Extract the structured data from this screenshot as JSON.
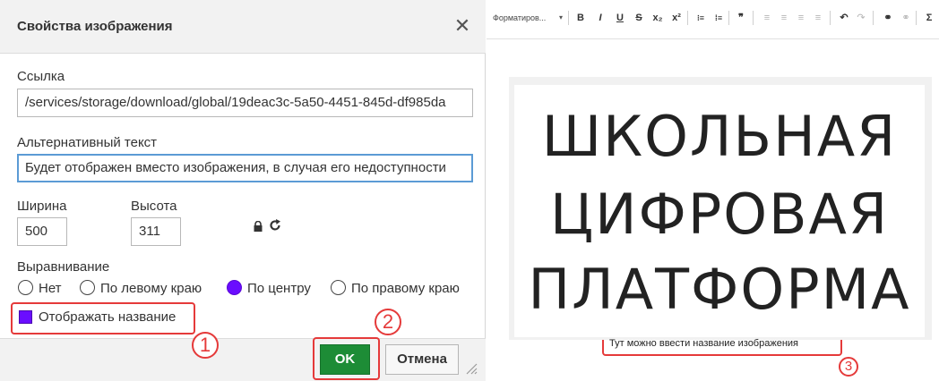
{
  "dialog": {
    "title": "Свойства изображения",
    "close_symbol": "✕",
    "link_label": "Ссылка",
    "link_value": "/services/storage/download/global/19deac3c-5a50-4451-845d-df985da",
    "alt_label": "Альтернативный текст",
    "alt_value": "Будет отображен вместо изображения, в случая его недоступности",
    "width_label": "Ширина",
    "width_value": "500",
    "height_label": "Высота",
    "height_value": "311",
    "align_label": "Выравнивание",
    "align_options": [
      {
        "label": "Нет",
        "selected": false
      },
      {
        "label": "По левому краю",
        "selected": false
      },
      {
        "label": "По центру",
        "selected": true
      },
      {
        "label": "По правому краю",
        "selected": false
      }
    ],
    "show_caption_label": "Отображать название",
    "show_caption_checked": true,
    "ok_label": "OK",
    "cancel_label": "Отмена",
    "icons": [
      "lock-icon",
      "refresh-icon",
      "close-icon",
      "resize-grip-icon"
    ]
  },
  "annotations": [
    "1",
    "2",
    "3"
  ],
  "editor": {
    "toolbar": {
      "format_label": "Форматиров...",
      "buttons": [
        "B",
        "I",
        "U",
        "S",
        "x₂",
        "x²",
        "⁝≡",
        "⁞≡",
        "❞",
        "≡",
        "≡",
        "≡",
        "≡",
        "↶",
        "↷",
        "⚭",
        "⚭",
        "Σ"
      ]
    },
    "image_lines": [
      "ШКОЛЬНАЯ",
      "ЦИФРОВАЯ",
      "ПЛАТФОРМА"
    ],
    "caption": "Тут можно ввести название изображения"
  },
  "colors": {
    "accent_purple": "#6a0dff",
    "ok_green": "#1d8c36",
    "annotation_red": "#e53a3a",
    "focus_blue": "#5b9bd5"
  }
}
